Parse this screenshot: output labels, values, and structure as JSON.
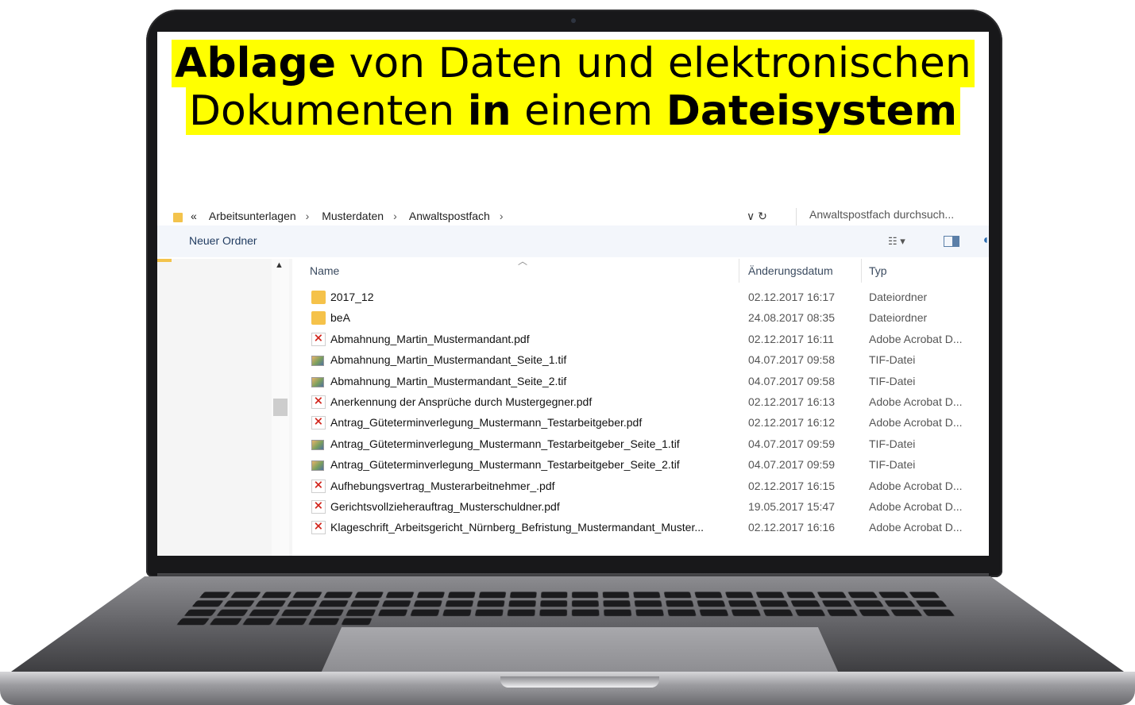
{
  "headline": {
    "line1": {
      "bold": "Ablage",
      "rest": " von Daten und elektronischen"
    },
    "line2": {
      "pre": "Dokumenten ",
      "bold1": "in",
      "mid": " einem ",
      "bold2": "Dateisystem"
    }
  },
  "address_bar": {
    "prefix": "«",
    "crumbs": [
      "Arbeitsunterlagen",
      "Musterdaten",
      "Anwaltspostfach"
    ],
    "separator": "›",
    "controls": "∨  ↻",
    "search_placeholder": "Anwaltspostfach durchsuch..."
  },
  "toolbar": {
    "new_folder_label": "Neuer Ordner",
    "view_icon": "details-view-icon",
    "pane_icon": "preview-pane-icon",
    "help_icon": "help-icon"
  },
  "columns": {
    "name": "Name",
    "date": "Änderungsdatum",
    "type": "Typ"
  },
  "files": [
    {
      "icon": "folder",
      "name": "2017_12",
      "date": "02.12.2017 16:17",
      "type": "Dateiordner"
    },
    {
      "icon": "folder",
      "name": "beA",
      "date": "24.08.2017 08:35",
      "type": "Dateiordner"
    },
    {
      "icon": "pdf",
      "name": "Abmahnung_Martin_Mustermandant.pdf",
      "date": "02.12.2017 16:11",
      "type": "Adobe Acrobat D..."
    },
    {
      "icon": "tif",
      "name": "Abmahnung_Martin_Mustermandant_Seite_1.tif",
      "date": "04.07.2017 09:58",
      "type": "TIF-Datei"
    },
    {
      "icon": "tif",
      "name": "Abmahnung_Martin_Mustermandant_Seite_2.tif",
      "date": "04.07.2017 09:58",
      "type": "TIF-Datei"
    },
    {
      "icon": "pdf",
      "name": "Anerkennung der Ansprüche durch Mustergegner.pdf",
      "date": "02.12.2017 16:13",
      "type": "Adobe Acrobat D..."
    },
    {
      "icon": "pdf",
      "name": "Antrag_Güteterminverlegung_Mustermann_Testarbeitgeber.pdf",
      "date": "02.12.2017 16:12",
      "type": "Adobe Acrobat D..."
    },
    {
      "icon": "tif",
      "name": "Antrag_Güteterminverlegung_Mustermann_Testarbeitgeber_Seite_1.tif",
      "date": "04.07.2017 09:59",
      "type": "TIF-Datei"
    },
    {
      "icon": "tif",
      "name": "Antrag_Güteterminverlegung_Mustermann_Testarbeitgeber_Seite_2.tif",
      "date": "04.07.2017 09:59",
      "type": "TIF-Datei"
    },
    {
      "icon": "pdf",
      "name": "Aufhebungsvertrag_Musterarbeitnehmer_.pdf",
      "date": "02.12.2017 16:15",
      "type": "Adobe Acrobat D..."
    },
    {
      "icon": "pdf",
      "name": "Gerichtsvollzieherauftrag_Musterschuldner.pdf",
      "date": "19.05.2017 15:47",
      "type": "Adobe Acrobat D..."
    },
    {
      "icon": "pdf",
      "name": "Klageschrift_Arbeitsgericht_Nürnberg_Befristung_Mustermandant_Muster...",
      "date": "02.12.2017 16:16",
      "type": "Adobe Acrobat D..."
    }
  ],
  "colors": {
    "highlight": "#ffff00",
    "folder": "#f5c24a",
    "pdf_red": "#d2281f",
    "toolbar_bg": "#f3f6fb"
  }
}
